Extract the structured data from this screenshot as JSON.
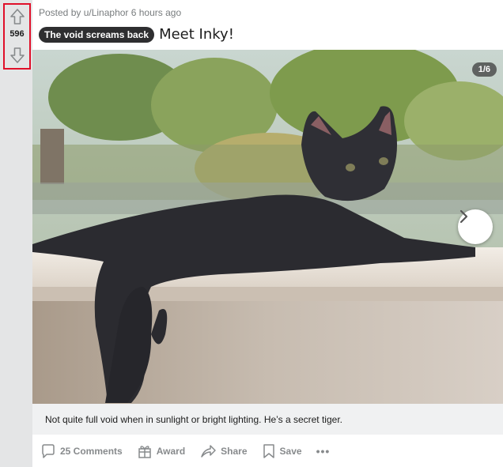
{
  "vote": {
    "score": "596",
    "highlight_color": "#e0102a"
  },
  "post": {
    "meta": "Posted by u/Linaphor 6 hours ago",
    "flair": "The void screams back",
    "title": "Meet Inky!",
    "gallery_counter": "1/6",
    "caption": "Not quite full void when in sunlight or bright lighting. He’s a secret tiger."
  },
  "actions": {
    "comments": "25 Comments",
    "award": "Award",
    "share": "Share",
    "save": "Save",
    "more": "•••"
  },
  "icons": [
    "upvote-arrow-icon",
    "downvote-arrow-icon",
    "chevron-right-icon",
    "comment-icon",
    "award-icon",
    "share-icon",
    "save-icon",
    "more-icon"
  ]
}
